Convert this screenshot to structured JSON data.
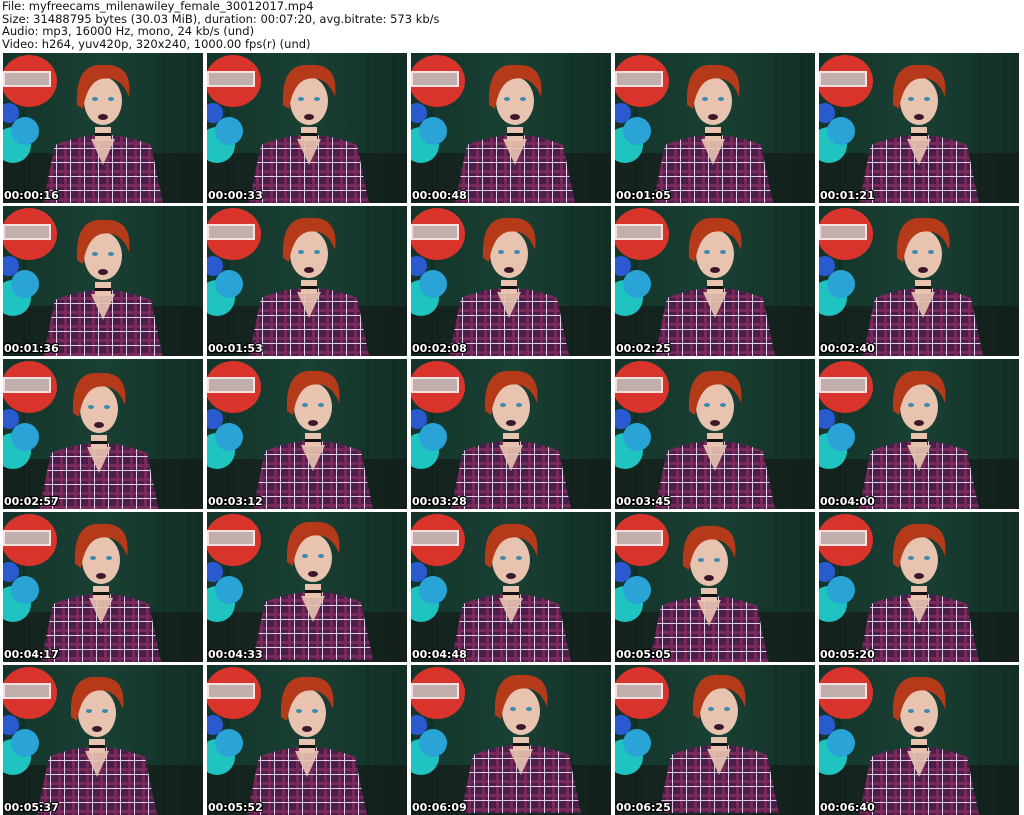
{
  "header": {
    "file_line": "File: myfreecams_milenawiley_female_30012017.mp4",
    "size_line": "Size: 31488795 bytes (30.03 MiB), duration: 00:07:20, avg.bitrate: 573 kb/s",
    "audio_line": "Audio: mp3, 16000 Hz, mono, 24 kb/s (und)",
    "video_line": "Video: h264, yuv420p, 320x240, 1000.00 fps(r) (und)"
  },
  "colors": {
    "wall": "#1f4a3c",
    "shirt": "#4a1f4a",
    "hair": "#b53a1a",
    "skin": "#e8c3b0",
    "balloon_blue": "#2aa4d6",
    "balloon_teal": "#1fc4c0",
    "balloon_red": "#d8342c",
    "lips": "#3a1a28"
  },
  "thumbnails": [
    {
      "timestamp": "00:00:16"
    },
    {
      "timestamp": "00:00:33"
    },
    {
      "timestamp": "00:00:48"
    },
    {
      "timestamp": "00:01:05"
    },
    {
      "timestamp": "00:01:21"
    },
    {
      "timestamp": "00:01:36"
    },
    {
      "timestamp": "00:01:53"
    },
    {
      "timestamp": "00:02:08"
    },
    {
      "timestamp": "00:02:25"
    },
    {
      "timestamp": "00:02:40"
    },
    {
      "timestamp": "00:02:57"
    },
    {
      "timestamp": "00:03:12"
    },
    {
      "timestamp": "00:03:28"
    },
    {
      "timestamp": "00:03:45"
    },
    {
      "timestamp": "00:04:00"
    },
    {
      "timestamp": "00:04:17"
    },
    {
      "timestamp": "00:04:33"
    },
    {
      "timestamp": "00:04:48"
    },
    {
      "timestamp": "00:05:05"
    },
    {
      "timestamp": "00:05:20"
    },
    {
      "timestamp": "00:05:37"
    },
    {
      "timestamp": "00:05:52"
    },
    {
      "timestamp": "00:06:09"
    },
    {
      "timestamp": "00:06:25"
    },
    {
      "timestamp": "00:06:40"
    }
  ]
}
